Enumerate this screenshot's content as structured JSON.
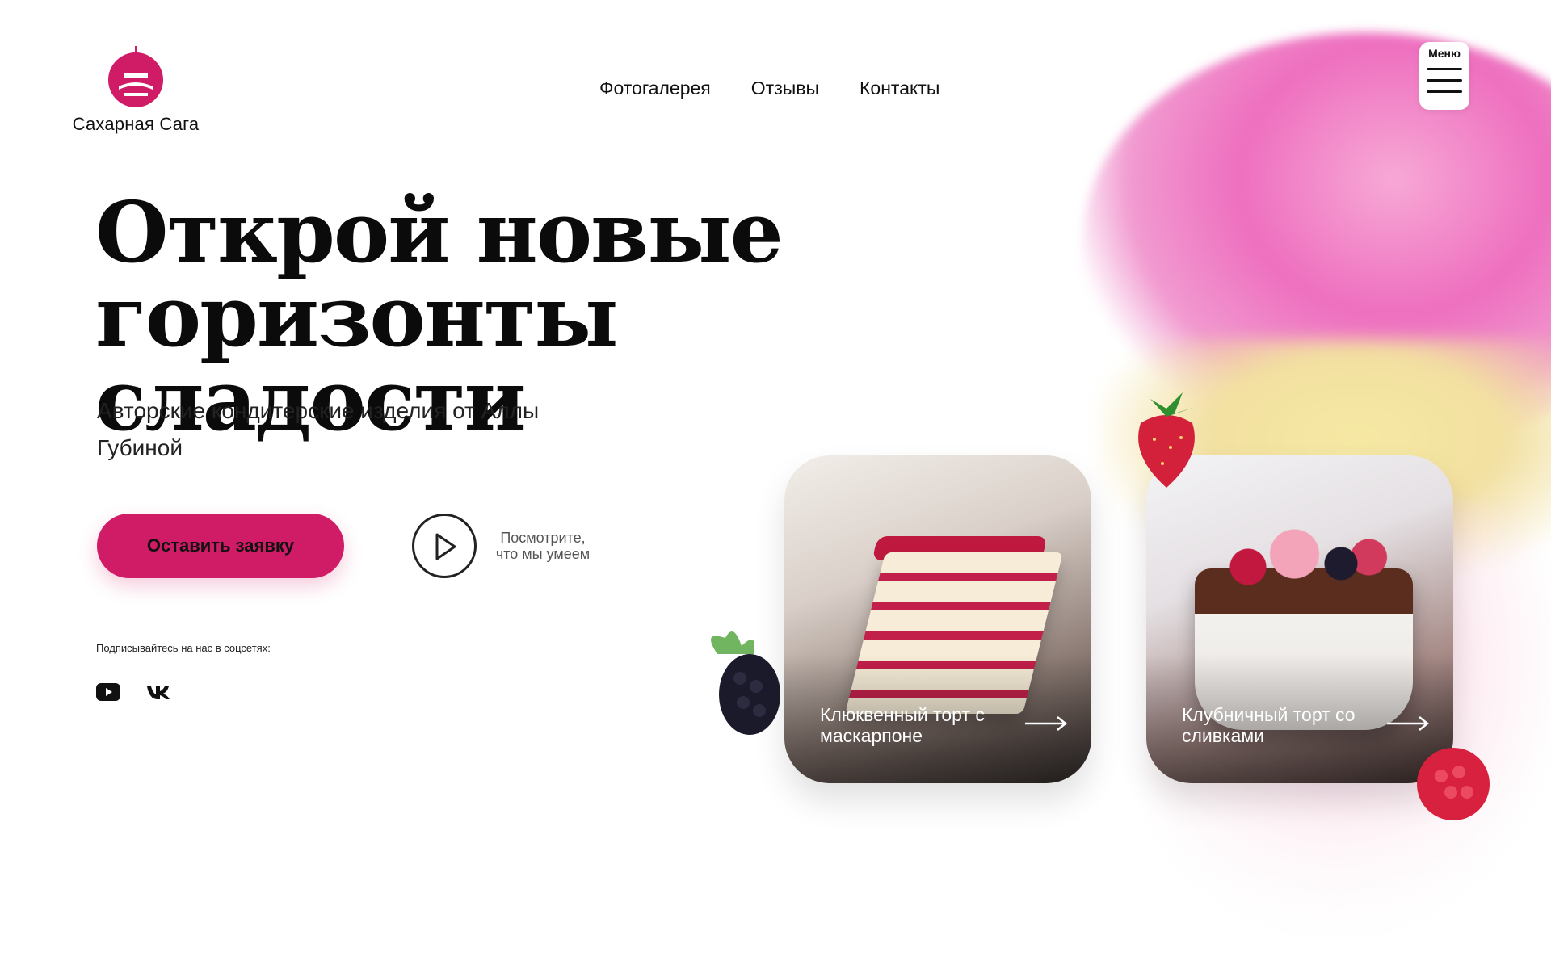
{
  "brand": {
    "name": "Сахарная Сага",
    "accent": "#d01b66"
  },
  "nav": {
    "items": [
      "Фотогалерея",
      "Отзывы",
      "Контакты"
    ]
  },
  "menu": {
    "label": "Меню"
  },
  "hero": {
    "title_line1": "Открой новые",
    "title_line2": "горизонты сладости",
    "subtitle_line1": "Авторские кондитерские изделия от Аллы",
    "subtitle_line2": "Губиной",
    "cta_label": "Оставить заявку",
    "video_text_line1": "Посмотрите,",
    "video_text_line2": "что мы умеем"
  },
  "social": {
    "label": "Подписывайтесь на нас в соцсетях:",
    "icons": [
      "youtube-icon",
      "vk-icon"
    ]
  },
  "cards": [
    {
      "title": "Клюквенный торт с маскарпоне",
      "icon": "arrow-right-icon"
    },
    {
      "title": "Клубничный торт со сливками",
      "icon": "arrow-right-icon"
    }
  ]
}
